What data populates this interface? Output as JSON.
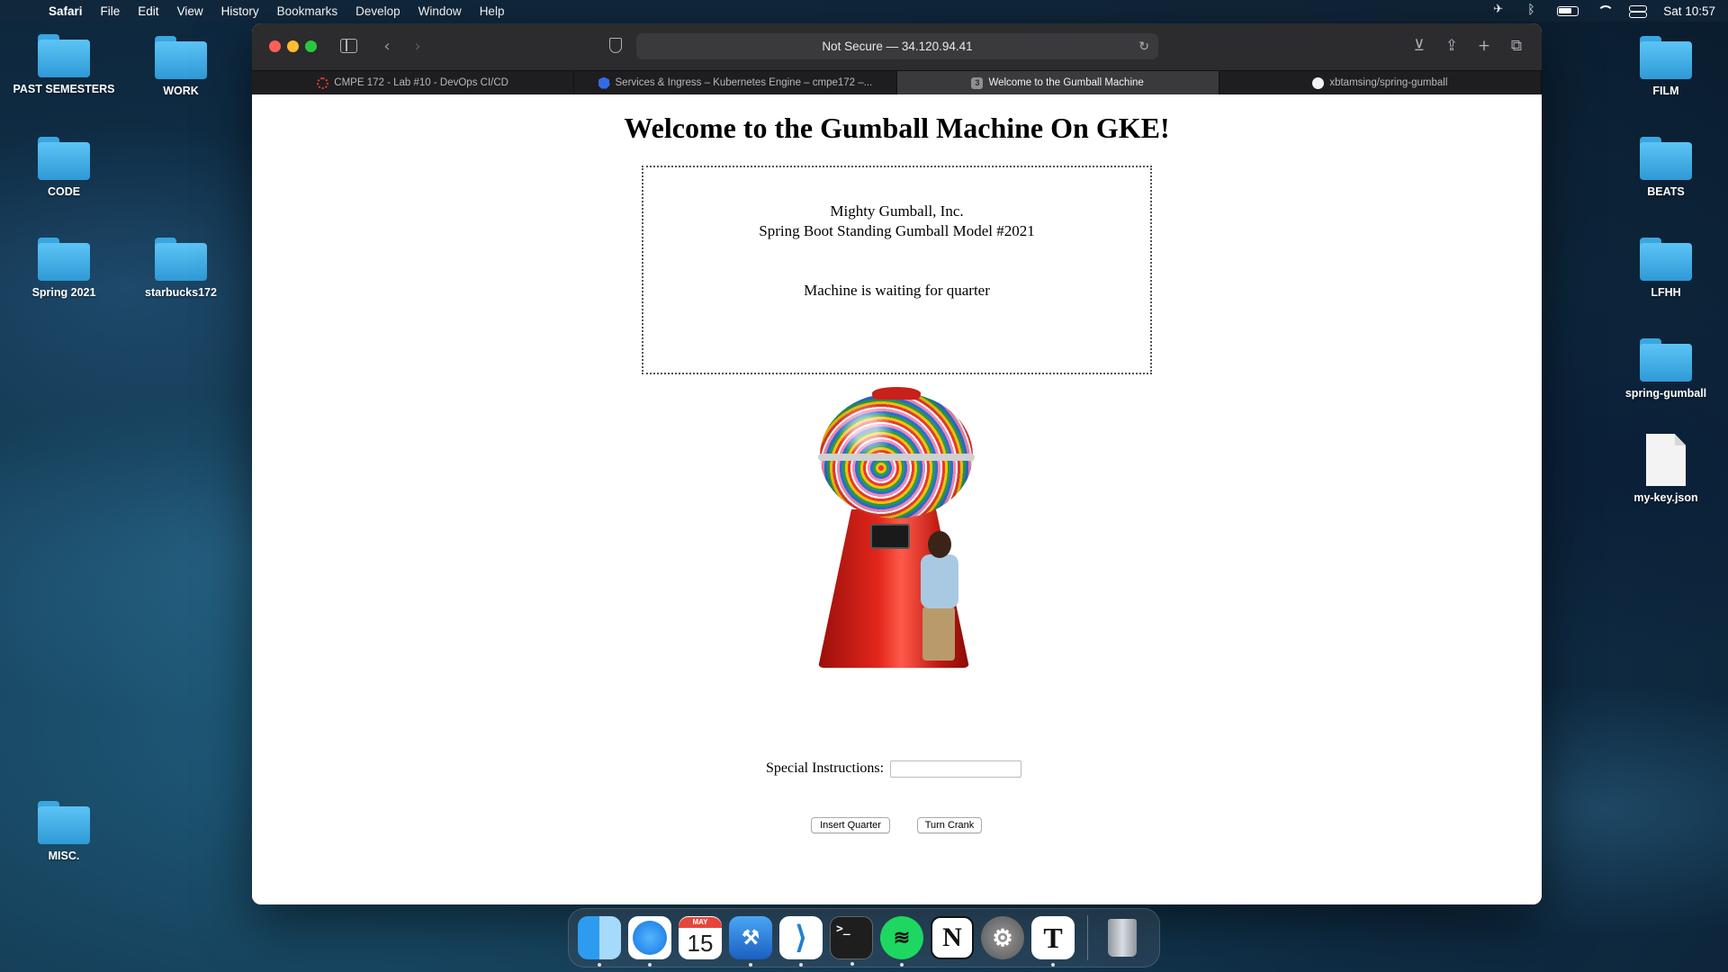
{
  "menubar": {
    "app_name": "Safari",
    "items": [
      "File",
      "Edit",
      "View",
      "History",
      "Bookmarks",
      "Develop",
      "Window",
      "Help"
    ],
    "clock": "Sat 10:57"
  },
  "desktop": {
    "left_icons": [
      {
        "label": "PAST SEMESTERS",
        "type": "folder"
      },
      {
        "label": "WORK",
        "type": "folder"
      },
      {
        "label": "CODE",
        "type": "folder"
      },
      {
        "label": "Spring 2021",
        "type": "folder"
      },
      {
        "label": "starbucks172",
        "type": "folder"
      },
      {
        "label": "MISC.",
        "type": "folder"
      }
    ],
    "right_icons": [
      {
        "label": "FILM",
        "type": "folder"
      },
      {
        "label": "BEATS",
        "type": "folder"
      },
      {
        "label": "LFHH",
        "type": "folder"
      },
      {
        "label": "spring-gumball",
        "type": "folder"
      },
      {
        "label": "my-key.json",
        "type": "file"
      }
    ]
  },
  "browser": {
    "address_text": "Not Secure — 34.120.94.41",
    "tabs": [
      {
        "label": "CMPE 172 - Lab #10 - DevOps CI/CD",
        "active": false,
        "favicon": "canvas-icon"
      },
      {
        "label": "Services & Ingress – Kubernetes Engine – cmpe172 –...",
        "active": false,
        "favicon": "kubernetes-icon"
      },
      {
        "label": "Welcome to the Gumball Machine",
        "active": true,
        "favicon": "number-3-icon",
        "badge": "3"
      },
      {
        "label": "xbtamsing/spring-gumball",
        "active": false,
        "favicon": "github-icon"
      }
    ]
  },
  "page": {
    "title": "Welcome to the Gumball Machine On GKE!",
    "company": "Mighty Gumball, Inc.",
    "model": "Spring Boot Standing Gumball Model #2021",
    "status": "Machine is waiting for quarter",
    "instructions_label": "Special Instructions:",
    "instructions_value": "",
    "insert_button": "Insert Quarter",
    "crank_button": "Turn Crank"
  },
  "dock": {
    "apps": [
      "Finder",
      "Safari",
      "Calendar",
      "Xcode",
      "Visual Studio Code",
      "Terminal",
      "Spotify",
      "Notion",
      "System Preferences",
      "Typora",
      "Trash"
    ],
    "calendar_month": "MAY",
    "calendar_day": "15"
  }
}
